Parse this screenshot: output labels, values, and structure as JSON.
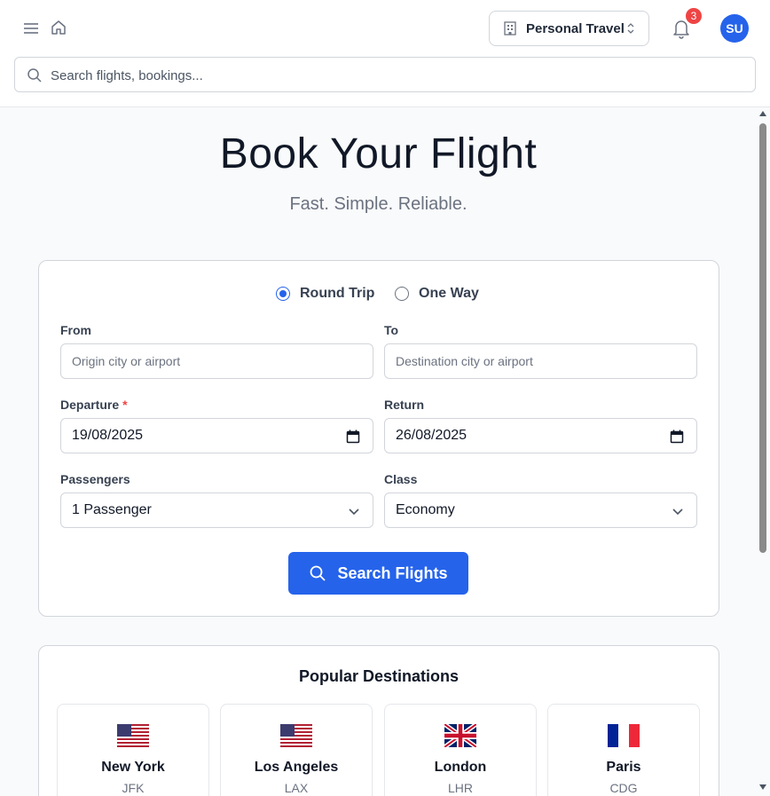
{
  "header": {
    "workspace_label": "Personal Travel",
    "notification_count": "3",
    "avatar_initials": "SU",
    "search_placeholder": "Search flights, bookings..."
  },
  "hero": {
    "title": "Book Your Flight",
    "subtitle": "Fast. Simple. Reliable."
  },
  "booking": {
    "trip_types": [
      {
        "label": "Round Trip",
        "selected": true
      },
      {
        "label": "One Way",
        "selected": false
      }
    ],
    "from_label": "From",
    "from_placeholder": "Origin city or airport",
    "to_label": "To",
    "to_placeholder": "Destination city or airport",
    "departure_label": "Departure",
    "departure_required_mark": "*",
    "departure_value": "19/08/2025",
    "return_label": "Return",
    "return_value": "26/08/2025",
    "passengers_label": "Passengers",
    "passengers_value": "1 Passenger",
    "class_label": "Class",
    "class_value": "Economy",
    "search_button": "Search Flights"
  },
  "popular": {
    "title": "Popular Destinations",
    "destinations": [
      {
        "city": "New York",
        "code": "JFK",
        "flag": "us-flag-icon"
      },
      {
        "city": "Los Angeles",
        "code": "LAX",
        "flag": "us-flag-icon"
      },
      {
        "city": "London",
        "code": "LHR",
        "flag": "uk-flag-icon"
      },
      {
        "city": "Paris",
        "code": "CDG",
        "flag": "france-flag-icon"
      }
    ]
  },
  "colors": {
    "primary": "#2563eb",
    "badge": "#ef4444",
    "required": "#ef4444"
  }
}
